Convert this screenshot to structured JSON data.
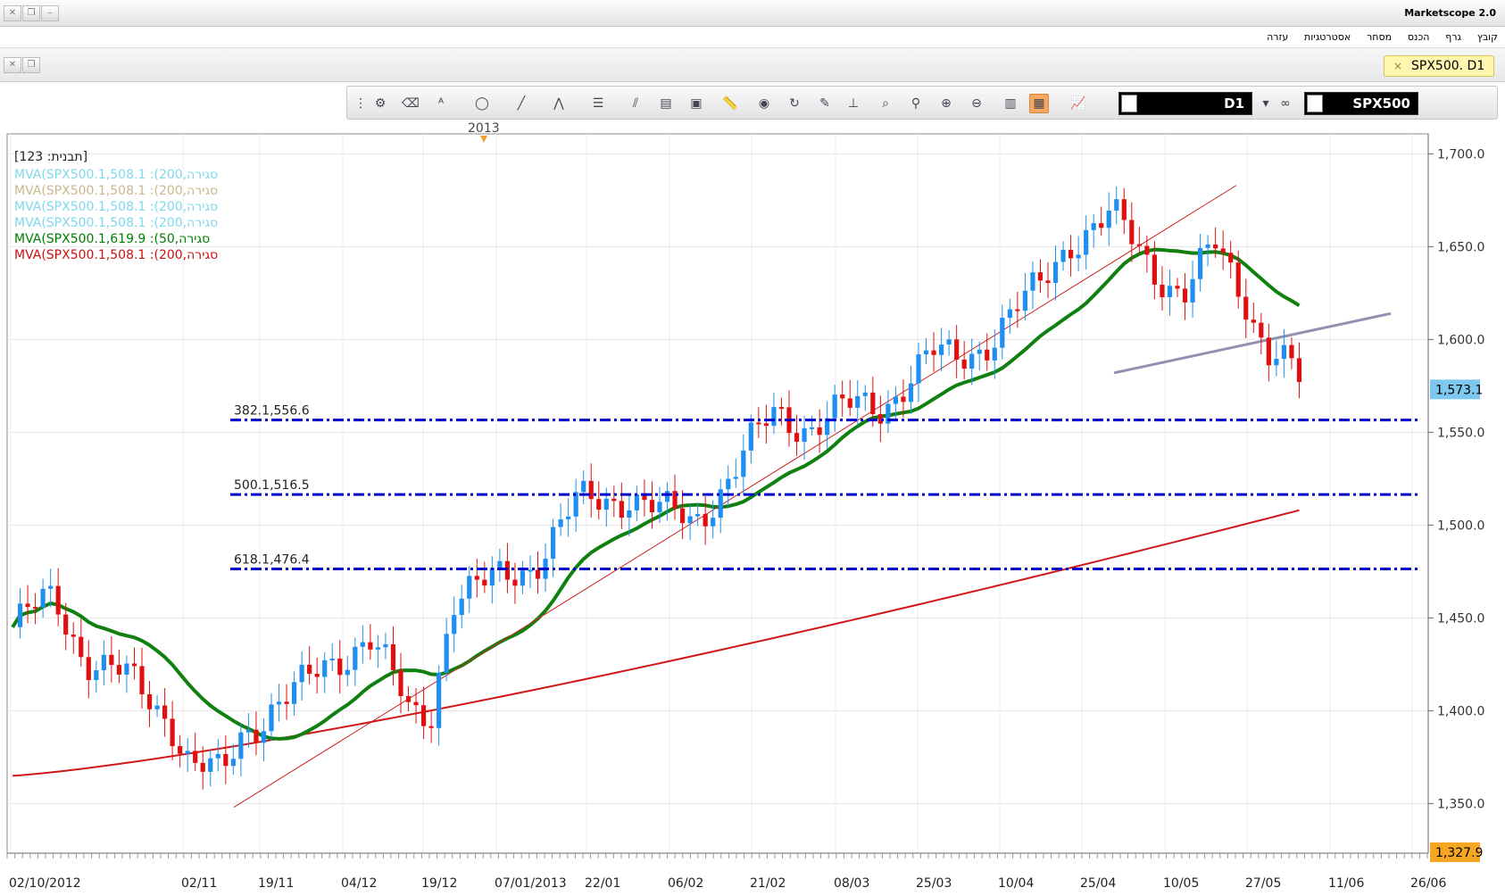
{
  "window": {
    "title": "Marketscope 2.0"
  },
  "menu": {
    "items": [
      "קובץ",
      "גרף",
      "הכנס",
      "מסחר",
      "אסטרטגיות",
      "עזרה"
    ]
  },
  "tab": {
    "label": "SPX500. D1",
    "close": "×"
  },
  "toolbar": {
    "timeframe": "D1",
    "symbol": "SPX500"
  },
  "chart": {
    "year_marker": "2013",
    "template_label": "[תבנית: 123]",
    "legend": [
      {
        "text": "MVA(SPX500.1,508.1 :(200,סגירה",
        "color": "#7fd8ec"
      },
      {
        "text": "MVA(SPX500.1,508.1 :(200,סגירה",
        "color": "#c8b88a"
      },
      {
        "text": "MVA(SPX500.1,508.1 :(200,סגירה",
        "color": "#7fd8ec"
      },
      {
        "text": "MVA(SPX500.1,508.1 :(200,סגירה",
        "color": "#7fd8ec"
      },
      {
        "text": "MVA(SPX500.1,619.9 :(50,סגירה",
        "color": "#008000"
      },
      {
        "text": "MVA(SPX500.1,508.1 :(200,סגירה",
        "color": "#d01010"
      }
    ],
    "fib_levels": [
      {
        "label": "382.1,556.6",
        "value": 1556.6
      },
      {
        "label": "500.1,516.5",
        "value": 1516.5
      },
      {
        "label": "618.1,476.4",
        "value": 1476.4
      }
    ],
    "price_labels": [
      "1,350.0",
      "1,400.0",
      "1,450.0",
      "1,500.0",
      "1,550.0",
      "1,600.0",
      "1,650.0",
      "1,700.0"
    ],
    "price_ticks": [
      1350,
      1400,
      1450,
      1500,
      1550,
      1600,
      1650,
      1700
    ],
    "current_price": {
      "label": "1,573.1",
      "value": 1573.1,
      "color": "#7ec8f0"
    },
    "low_price": {
      "label": "1,327.9",
      "value": 1327.9,
      "color": "#f5a623"
    },
    "date_labels": [
      "02/10/2012",
      "02/11",
      "19/11",
      "04/12",
      "19/12",
      "07/01/2013",
      "22/01",
      "06/02",
      "21/02",
      "08/03",
      "25/03",
      "10/04",
      "25/04",
      "10/05",
      "27/05",
      "11/06",
      "26/06"
    ],
    "colors": {
      "up": "#1e8ff0",
      "down": "#e01010",
      "ma50": "#108010",
      "ma200": "#d01818",
      "fib": "#0000cc",
      "channel": "#cc2222",
      "trend": "#9090b0"
    }
  }
}
